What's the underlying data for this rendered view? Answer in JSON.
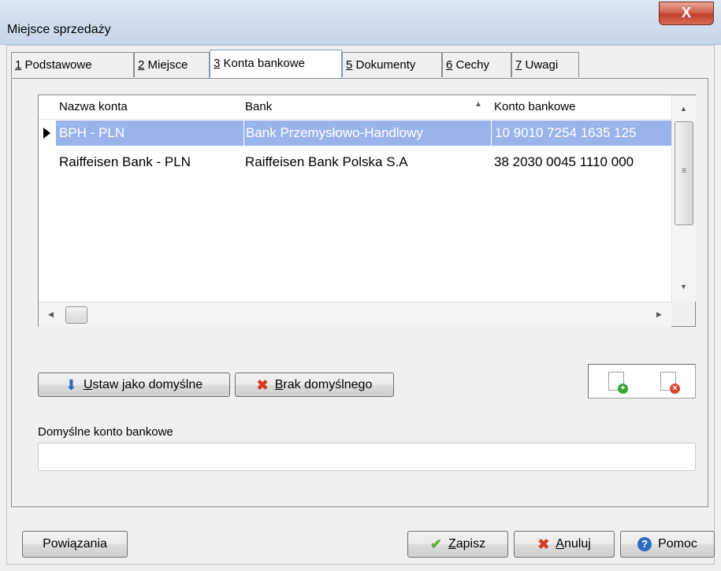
{
  "window": {
    "title": "Miejsce sprzedaży",
    "close_glyph": "X"
  },
  "tabs": [
    {
      "mnemonic": "1",
      "label": " Podstawowe",
      "active": false
    },
    {
      "mnemonic": "2",
      "label": " Miejsce",
      "active": false
    },
    {
      "mnemonic": "3",
      "label": " Konta bankowe",
      "active": true
    },
    {
      "mnemonic": "5",
      "label": " Dokumenty",
      "active": false
    },
    {
      "mnemonic": "6",
      "label": " Cechy",
      "active": false
    },
    {
      "mnemonic": "7",
      "label": " Uwagi",
      "active": false
    }
  ],
  "grid": {
    "columns": [
      "Nazwa konta",
      "Bank",
      "Konto bankowe"
    ],
    "sorted_column": "Bank",
    "rows": [
      {
        "name": "BPH - PLN",
        "bank": "Bank Przemysłowo-Handlowy",
        "account": "10 9010 7254 1635 125",
        "selected": true
      },
      {
        "name": "Raiffeisen Bank - PLN",
        "bank": "Raiffeisen Bank Polska S.A",
        "account": "38 2030 0045 1110 000",
        "selected": false
      }
    ]
  },
  "buttons": {
    "set_default": {
      "mnemonic": "U",
      "rest": "staw jako domyślne",
      "icon": "arrow-down-icon"
    },
    "no_default": {
      "mnemonic": "B",
      "rest": "rak domyślnego",
      "icon": "red-x-icon"
    },
    "links": {
      "label": "Powiązania"
    },
    "save": {
      "mnemonic": "Z",
      "rest": "apisz",
      "icon": "checkmark-icon"
    },
    "cancel": {
      "mnemonic": "A",
      "rest": "nuluj",
      "icon": "red-x-icon"
    },
    "help": {
      "label": "Pomoc",
      "icon": "help-icon"
    }
  },
  "default_account": {
    "label": "Domyślne konto bankowe",
    "value": ""
  },
  "colors": {
    "selection": "#99b4ea",
    "close_button": "#c9462f",
    "help_icon": "#2f6cc0"
  }
}
